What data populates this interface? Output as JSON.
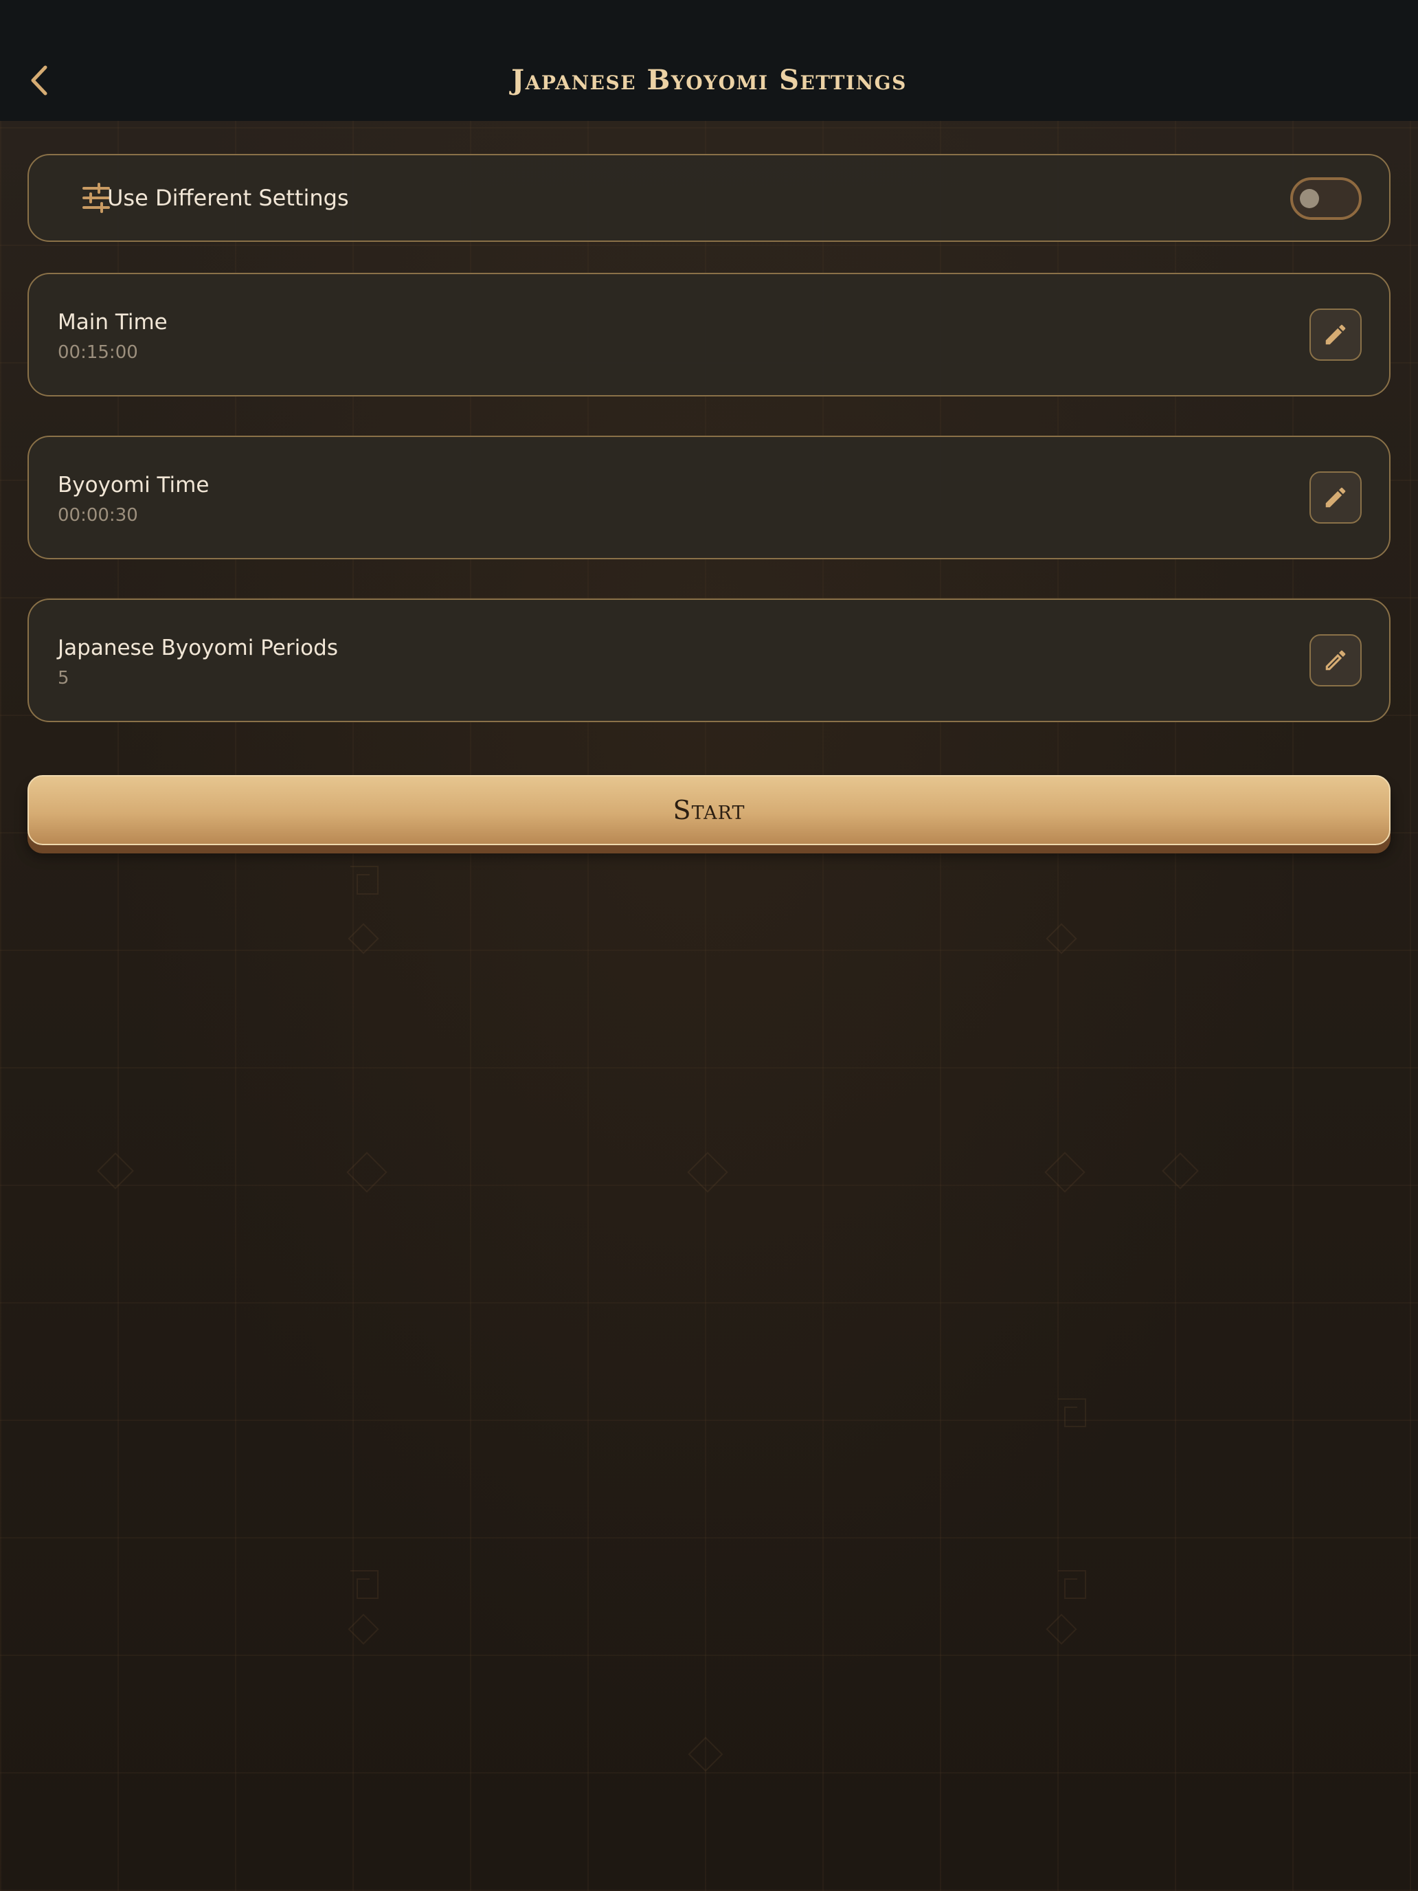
{
  "header": {
    "title": "Japanese Byoyomi Settings",
    "back_icon": "chevron-left-icon"
  },
  "toggle_setting": {
    "label": "Use Different Settings",
    "icon": "tune-icon",
    "enabled": false
  },
  "settings": [
    {
      "label": "Main Time",
      "value": "00:15:00",
      "action_icon": "pencil-icon"
    },
    {
      "label": "Byoyomi Time",
      "value": "00:00:30",
      "action_icon": "pencil-icon"
    },
    {
      "label": "Japanese Byoyomi Periods",
      "value": "5",
      "action_icon": "pencil-icon"
    }
  ],
  "start_button": {
    "label": "Start"
  },
  "colors": {
    "accent": "#d6ac73",
    "header_bg": "#121517",
    "card_bg": "#2c2822",
    "card_border": "#8a7148",
    "title_text": "#ecd2a5",
    "primary_text": "#f1e6d6",
    "secondary_text": "#9c8f7d"
  }
}
